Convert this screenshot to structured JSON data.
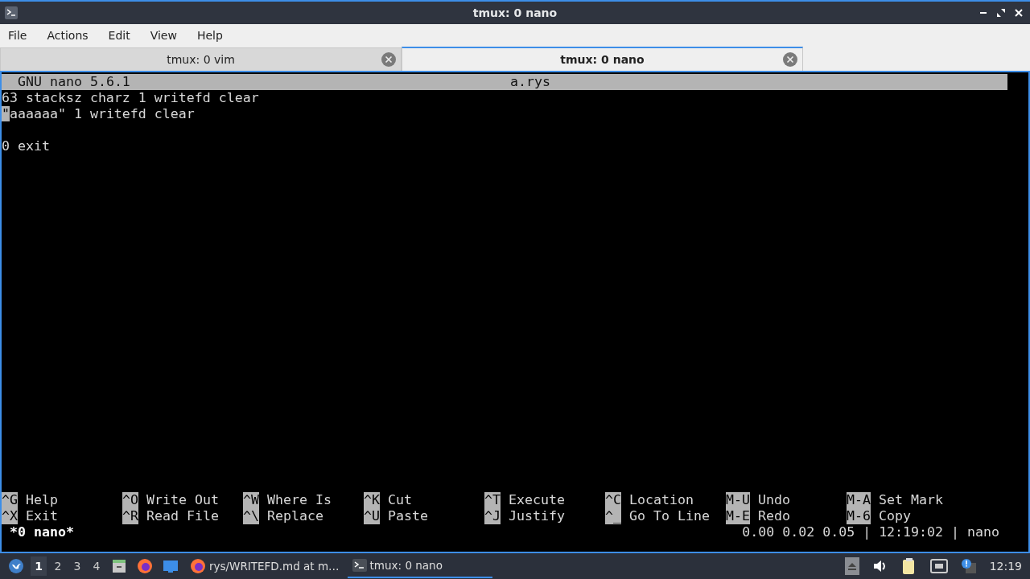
{
  "window": {
    "title": "tmux: 0 nano"
  },
  "menu": [
    "File",
    "Actions",
    "Edit",
    "View",
    "Help"
  ],
  "tabs": [
    {
      "label": "tmux: 0 vim",
      "selected": false
    },
    {
      "label": "tmux: 0 nano",
      "selected": true
    }
  ],
  "nano": {
    "version": "GNU nano 5.6.1",
    "filename": "a.rys",
    "lines": [
      {
        "kind": "text",
        "text": "63 stacksz charz 1 writefd clear",
        "cursor": false
      },
      {
        "kind": "text",
        "text": "\"aaaaaa\" 1 writefd clear",
        "cursor": true
      },
      {
        "kind": "blank"
      },
      {
        "kind": "text",
        "text": "0 exit",
        "cursor": false
      }
    ],
    "shortcuts": [
      [
        {
          "key": "^G",
          "label": "Help"
        },
        {
          "key": "^O",
          "label": "Write Out"
        },
        {
          "key": "^W",
          "label": "Where Is"
        },
        {
          "key": "^K",
          "label": "Cut"
        },
        {
          "key": "^T",
          "label": "Execute"
        },
        {
          "key": "^C",
          "label": "Location"
        },
        {
          "key": "M-U",
          "label": "Undo"
        },
        {
          "key": "M-A",
          "label": "Set Mark"
        }
      ],
      [
        {
          "key": "^X",
          "label": "Exit"
        },
        {
          "key": "^R",
          "label": "Read File"
        },
        {
          "key": "^\\",
          "label": "Replace"
        },
        {
          "key": "^U",
          "label": "Paste"
        },
        {
          "key": "^J",
          "label": "Justify"
        },
        {
          "key": "^_",
          "label": "Go To Line"
        },
        {
          "key": "M-E",
          "label": "Redo"
        },
        {
          "key": "M-6",
          "label": "Copy"
        }
      ]
    ]
  },
  "tmux_status": {
    "window": "*0 nano*",
    "right": "0.00 0.02 0.05 | 12:19:02 | nano"
  },
  "taskbar": {
    "workspaces": [
      {
        "label": "1",
        "selected": true
      },
      {
        "label": "2",
        "selected": false
      },
      {
        "label": "3",
        "selected": false
      },
      {
        "label": "4",
        "selected": false
      }
    ],
    "tasks": [
      {
        "kind": "browser",
        "label": "rys/WRITEFD.md at m…",
        "selected": false
      },
      {
        "kind": "terminal",
        "label": "tmux: 0 nano",
        "selected": true
      }
    ],
    "clock": "12:19"
  }
}
